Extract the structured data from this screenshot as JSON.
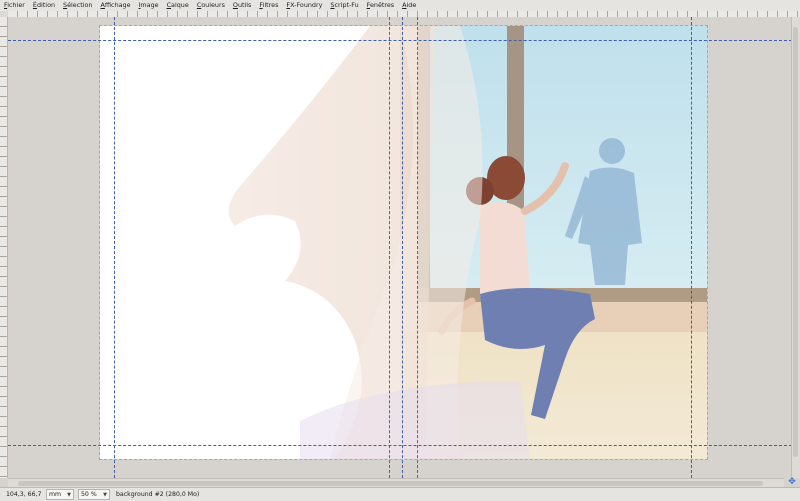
{
  "menu": [
    "Fichier",
    "Édition",
    "Sélection",
    "Affichage",
    "Image",
    "Calque",
    "Couleurs",
    "Outils",
    "Filtres",
    "FX-Foundry",
    "Script-Fu",
    "Fenêtres",
    "Aide"
  ],
  "status": {
    "coordinates": "104,3, 66,7",
    "unit": "mm",
    "zoom": "50 %",
    "message": "background #2 (280,0 Mo)"
  },
  "icons": {
    "navigate": "nav-cross-icon"
  },
  "colors": {
    "guide": "#3e5fa8",
    "guide_red": "#b04242",
    "sky": "#a9d3e6",
    "wall": "#f0e2d2"
  }
}
